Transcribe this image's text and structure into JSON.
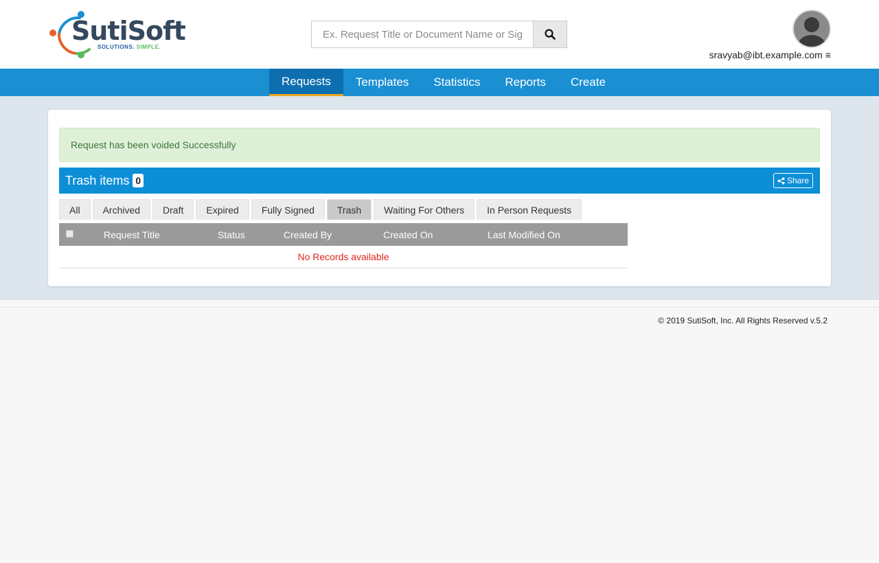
{
  "brand": {
    "name": "SutiSoft",
    "registered_mark": "®",
    "tagline_part1": "SOLUTIONS.",
    "tagline_part2": "SIMPLE.",
    "colors": {
      "text": "#34495e",
      "tagline_blue": "#1f5fa8",
      "tagline_green": "#5cb85c",
      "dot_orange": "#e8612c",
      "dot_blue": "#1a8fd2",
      "dot_green": "#5cb85c"
    }
  },
  "search": {
    "placeholder": "Ex. Request Title or Document Name or Signer Name",
    "button_icon": "search-icon"
  },
  "user": {
    "email": "sravyab@ibt.example.com",
    "menu_icon": "hamburger-icon",
    "avatar_icon": "user-avatar-icon"
  },
  "nav": {
    "tabs": [
      {
        "label": "Requests",
        "active": true
      },
      {
        "label": "Templates",
        "active": false
      },
      {
        "label": "Statistics",
        "active": false
      },
      {
        "label": "Reports",
        "active": false
      },
      {
        "label": "Create",
        "active": false
      }
    ],
    "colors": {
      "bar": "#1a8fd2",
      "active_bg": "#0d6fb0",
      "active_underline": "#f3a61c"
    }
  },
  "alert": {
    "message": "Request has been voided Successfully",
    "colors": {
      "bg": "#dff0d8",
      "text": "#3c763d"
    }
  },
  "trash_header": {
    "title": "Trash items",
    "count": "0",
    "share_label": "Share",
    "share_icon": "share-icon",
    "color": "#0d8fd8"
  },
  "filter_tabs": [
    {
      "label": "All",
      "active": false
    },
    {
      "label": "Archived",
      "active": false
    },
    {
      "label": "Draft",
      "active": false
    },
    {
      "label": "Expired",
      "active": false
    },
    {
      "label": "Fully Signed",
      "active": false
    },
    {
      "label": "Trash",
      "active": true
    },
    {
      "label": "Waiting For Others",
      "active": false
    },
    {
      "label": "In Person Requests",
      "active": false
    }
  ],
  "table": {
    "columns": [
      "Request Title",
      "Status",
      "Created By",
      "Created On",
      "Last Modified On"
    ],
    "empty_message": "No Records available",
    "header_color": "#9a9a9a",
    "empty_color": "#e0261d"
  },
  "footer": {
    "text": "© 2019 SutiSoft, Inc. All Rights Reserved v.5.2"
  }
}
